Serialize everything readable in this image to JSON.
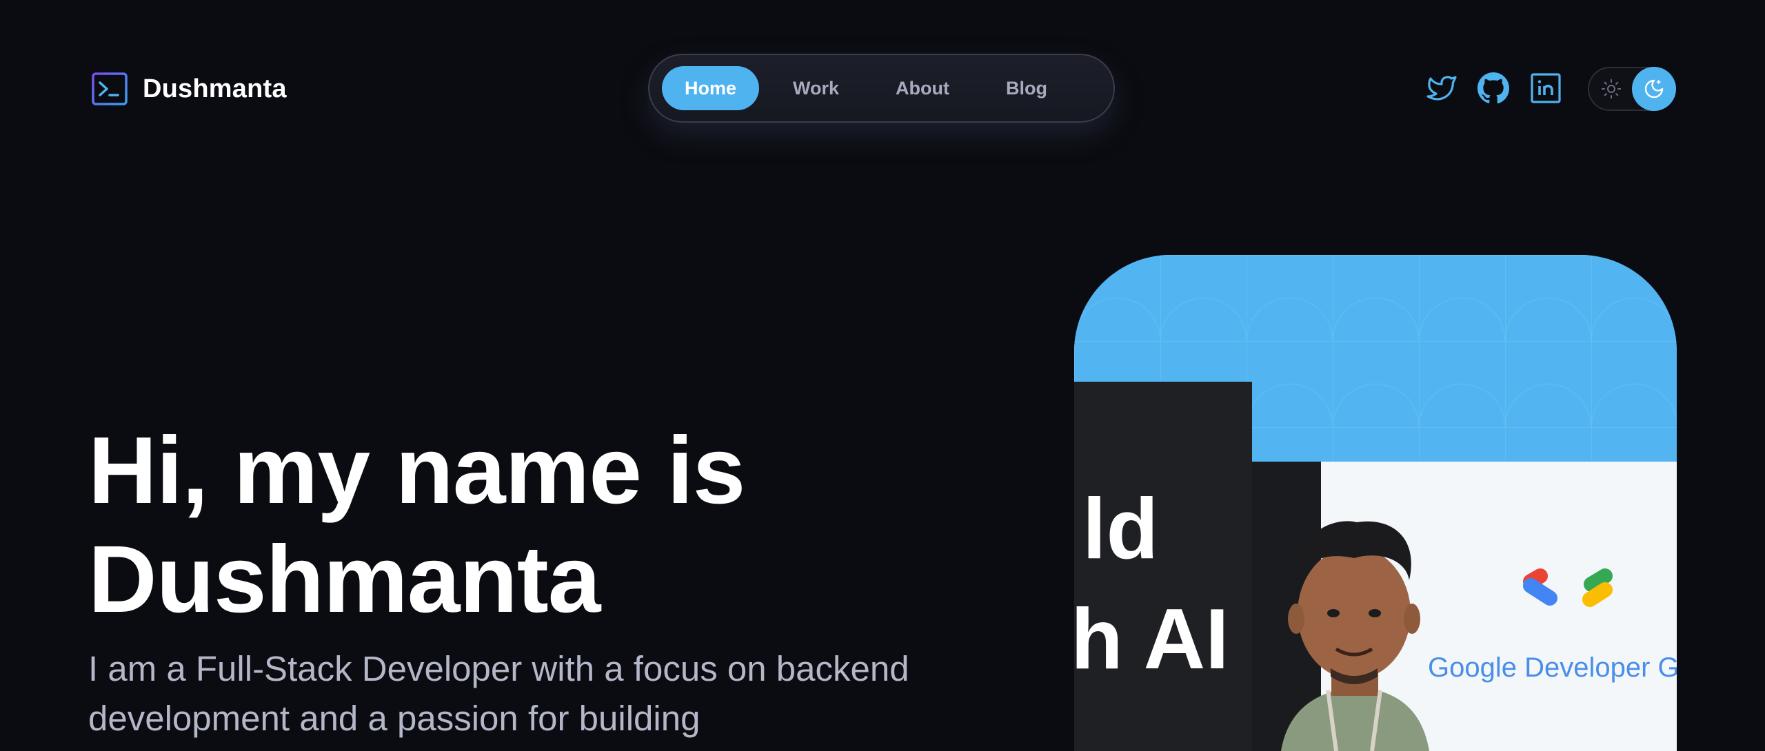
{
  "brand": {
    "name": "Dushmanta",
    "icon": "terminal-icon"
  },
  "nav": {
    "items": [
      {
        "label": "Home",
        "active": true
      },
      {
        "label": "Work",
        "active": false
      },
      {
        "label": "About",
        "active": false
      },
      {
        "label": "Blog",
        "active": false
      }
    ]
  },
  "social": {
    "icons": [
      "twitter-icon",
      "github-icon",
      "linkedin-icon"
    ]
  },
  "theme_toggle": {
    "icons": [
      "sun-icon",
      "moon-icon"
    ],
    "selected": "dark"
  },
  "hero": {
    "title_line1": "Hi, my name is",
    "title_line2": "Dushmanta",
    "description": "I am a Full-Stack Developer with a focus on backend development and a passion for building"
  },
  "photo": {
    "slide_line1": "ld",
    "slide_line2": "h AI",
    "banner_text": "Google Developer G"
  },
  "colors": {
    "background": "#0b0c11",
    "accent": "#4fb3f0",
    "nav_text": "#a7abbd",
    "body_text": "#b3b7c8"
  }
}
